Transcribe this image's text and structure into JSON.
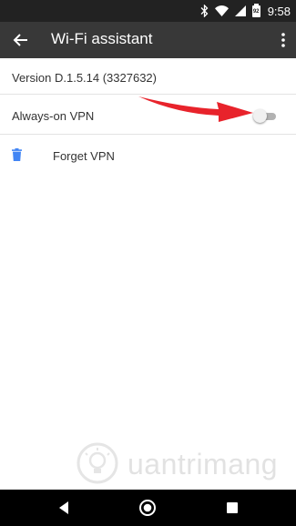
{
  "status_bar": {
    "time": "9:58",
    "battery_level": "92",
    "icons": [
      "bluetooth-icon",
      "wifi-icon",
      "signal-icon",
      "battery-icon"
    ]
  },
  "app_bar": {
    "title": "Wi-Fi assistant",
    "back_icon": "arrow-left-icon",
    "overflow_icon": "more-vertical-icon"
  },
  "settings": {
    "version": "Version D.1.5.14 (3327632)",
    "always_on_vpn": {
      "label": "Always-on VPN",
      "enabled": false
    },
    "forget_vpn": {
      "label": "Forget VPN",
      "icon": "trash-icon"
    }
  },
  "annotation": {
    "arrow_color": "#e8232b"
  },
  "watermark": {
    "text": "uantrimang"
  },
  "nav_bar": {
    "buttons": [
      "back-triangle-icon",
      "home-circle-icon",
      "recents-square-icon"
    ]
  },
  "colors": {
    "app_bar": "#383838",
    "status_bar": "#222222",
    "accent_blue": "#4285f4",
    "annotation_red": "#e8232b"
  }
}
